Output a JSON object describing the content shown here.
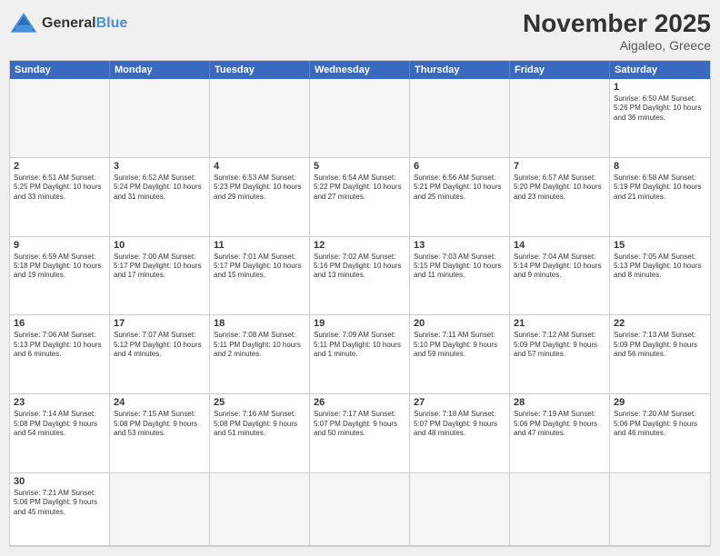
{
  "header": {
    "logo_general": "General",
    "logo_blue": "Blue",
    "month_title": "November 2025",
    "location": "Aigaleo, Greece"
  },
  "day_headers": [
    "Sunday",
    "Monday",
    "Tuesday",
    "Wednesday",
    "Thursday",
    "Friday",
    "Saturday"
  ],
  "cells": [
    {
      "day": "",
      "empty": true,
      "info": ""
    },
    {
      "day": "",
      "empty": true,
      "info": ""
    },
    {
      "day": "",
      "empty": true,
      "info": ""
    },
    {
      "day": "",
      "empty": true,
      "info": ""
    },
    {
      "day": "",
      "empty": true,
      "info": ""
    },
    {
      "day": "",
      "empty": true,
      "info": ""
    },
    {
      "day": "1",
      "empty": false,
      "info": "Sunrise: 6:50 AM\nSunset: 5:26 PM\nDaylight: 10 hours\nand 36 minutes."
    },
    {
      "day": "2",
      "empty": false,
      "info": "Sunrise: 6:51 AM\nSunset: 5:25 PM\nDaylight: 10 hours\nand 33 minutes."
    },
    {
      "day": "3",
      "empty": false,
      "info": "Sunrise: 6:52 AM\nSunset: 5:24 PM\nDaylight: 10 hours\nand 31 minutes."
    },
    {
      "day": "4",
      "empty": false,
      "info": "Sunrise: 6:53 AM\nSunset: 5:23 PM\nDaylight: 10 hours\nand 29 minutes."
    },
    {
      "day": "5",
      "empty": false,
      "info": "Sunrise: 6:54 AM\nSunset: 5:22 PM\nDaylight: 10 hours\nand 27 minutes."
    },
    {
      "day": "6",
      "empty": false,
      "info": "Sunrise: 6:56 AM\nSunset: 5:21 PM\nDaylight: 10 hours\nand 25 minutes."
    },
    {
      "day": "7",
      "empty": false,
      "info": "Sunrise: 6:57 AM\nSunset: 5:20 PM\nDaylight: 10 hours\nand 23 minutes."
    },
    {
      "day": "8",
      "empty": false,
      "info": "Sunrise: 6:58 AM\nSunset: 5:19 PM\nDaylight: 10 hours\nand 21 minutes."
    },
    {
      "day": "9",
      "empty": false,
      "info": "Sunrise: 6:59 AM\nSunset: 5:18 PM\nDaylight: 10 hours\nand 19 minutes."
    },
    {
      "day": "10",
      "empty": false,
      "info": "Sunrise: 7:00 AM\nSunset: 5:17 PM\nDaylight: 10 hours\nand 17 minutes."
    },
    {
      "day": "11",
      "empty": false,
      "info": "Sunrise: 7:01 AM\nSunset: 5:17 PM\nDaylight: 10 hours\nand 15 minutes."
    },
    {
      "day": "12",
      "empty": false,
      "info": "Sunrise: 7:02 AM\nSunset: 5:16 PM\nDaylight: 10 hours\nand 13 minutes."
    },
    {
      "day": "13",
      "empty": false,
      "info": "Sunrise: 7:03 AM\nSunset: 5:15 PM\nDaylight: 10 hours\nand 11 minutes."
    },
    {
      "day": "14",
      "empty": false,
      "info": "Sunrise: 7:04 AM\nSunset: 5:14 PM\nDaylight: 10 hours\nand 9 minutes."
    },
    {
      "day": "15",
      "empty": false,
      "info": "Sunrise: 7:05 AM\nSunset: 5:13 PM\nDaylight: 10 hours\nand 8 minutes."
    },
    {
      "day": "16",
      "empty": false,
      "info": "Sunrise: 7:06 AM\nSunset: 5:13 PM\nDaylight: 10 hours\nand 6 minutes."
    },
    {
      "day": "17",
      "empty": false,
      "info": "Sunrise: 7:07 AM\nSunset: 5:12 PM\nDaylight: 10 hours\nand 4 minutes."
    },
    {
      "day": "18",
      "empty": false,
      "info": "Sunrise: 7:08 AM\nSunset: 5:11 PM\nDaylight: 10 hours\nand 2 minutes."
    },
    {
      "day": "19",
      "empty": false,
      "info": "Sunrise: 7:09 AM\nSunset: 5:11 PM\nDaylight: 10 hours\nand 1 minute."
    },
    {
      "day": "20",
      "empty": false,
      "info": "Sunrise: 7:11 AM\nSunset: 5:10 PM\nDaylight: 9 hours\nand 59 minutes."
    },
    {
      "day": "21",
      "empty": false,
      "info": "Sunrise: 7:12 AM\nSunset: 5:09 PM\nDaylight: 9 hours\nand 57 minutes."
    },
    {
      "day": "22",
      "empty": false,
      "info": "Sunrise: 7:13 AM\nSunset: 5:09 PM\nDaylight: 9 hours\nand 56 minutes."
    },
    {
      "day": "23",
      "empty": false,
      "info": "Sunrise: 7:14 AM\nSunset: 5:08 PM\nDaylight: 9 hours\nand 54 minutes."
    },
    {
      "day": "24",
      "empty": false,
      "info": "Sunrise: 7:15 AM\nSunset: 5:08 PM\nDaylight: 9 hours\nand 53 minutes."
    },
    {
      "day": "25",
      "empty": false,
      "info": "Sunrise: 7:16 AM\nSunset: 5:08 PM\nDaylight: 9 hours\nand 51 minutes."
    },
    {
      "day": "26",
      "empty": false,
      "info": "Sunrise: 7:17 AM\nSunset: 5:07 PM\nDaylight: 9 hours\nand 50 minutes."
    },
    {
      "day": "27",
      "empty": false,
      "info": "Sunrise: 7:18 AM\nSunset: 5:07 PM\nDaylight: 9 hours\nand 48 minutes."
    },
    {
      "day": "28",
      "empty": false,
      "info": "Sunrise: 7:19 AM\nSunset: 5:06 PM\nDaylight: 9 hours\nand 47 minutes."
    },
    {
      "day": "29",
      "empty": false,
      "info": "Sunrise: 7:20 AM\nSunset: 5:06 PM\nDaylight: 9 hours\nand 46 minutes."
    },
    {
      "day": "30",
      "empty": false,
      "info": "Sunrise: 7:21 AM\nSunset: 5:06 PM\nDaylight: 9 hours\nand 45 minutes."
    },
    {
      "day": "",
      "empty": true,
      "info": ""
    },
    {
      "day": "",
      "empty": true,
      "info": ""
    },
    {
      "day": "",
      "empty": true,
      "info": ""
    },
    {
      "day": "",
      "empty": true,
      "info": ""
    },
    {
      "day": "",
      "empty": true,
      "info": ""
    },
    {
      "day": "",
      "empty": true,
      "info": ""
    },
    {
      "day": "",
      "empty": true,
      "info": ""
    }
  ]
}
